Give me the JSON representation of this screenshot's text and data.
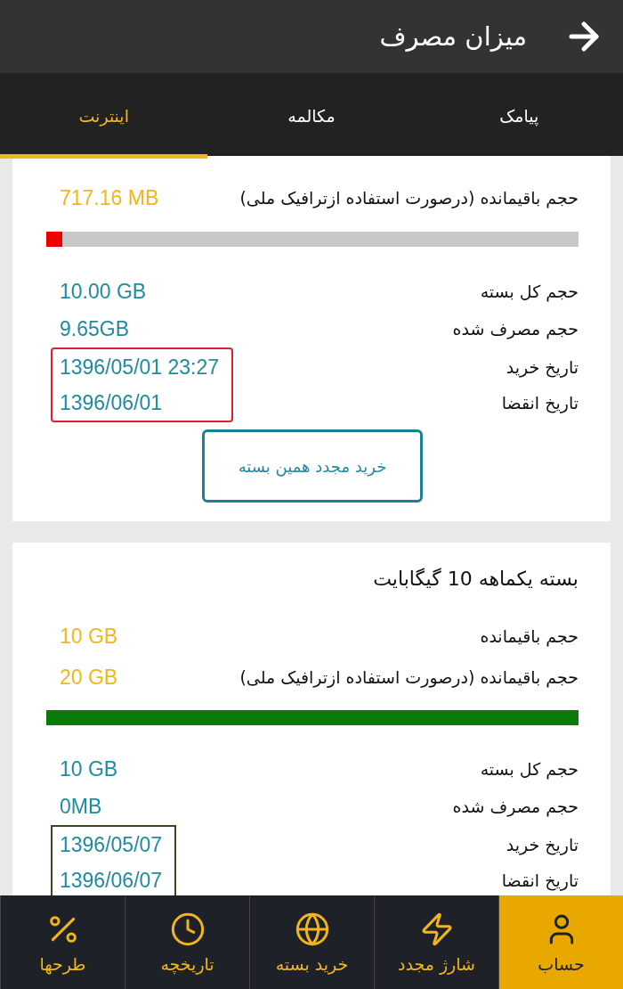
{
  "header": {
    "title": "میزان مصرف"
  },
  "tabs": [
    {
      "label": "پیامک",
      "selected": false
    },
    {
      "label": "مکالمه",
      "selected": false
    },
    {
      "label": "اینترنت",
      "selected": true
    }
  ],
  "cards": [
    {
      "remaining": [
        {
          "label": "حجم باقیمانده (درصورت استفاده ازترافیک ملی)",
          "value": "717.16 MB"
        }
      ],
      "bar": {
        "level": 0.03,
        "color": "#ee0000"
      },
      "details": [
        {
          "label": "حجم کل بسته",
          "value": "10.00 GB"
        },
        {
          "label": "حجم مصرف شده",
          "value": "9.65GB"
        }
      ],
      "dates": [
        {
          "label": "تاریخ خرید",
          "value": "1396/05/01 23:27"
        },
        {
          "label": "تاریخ انقضا",
          "value": "1396/06/01"
        }
      ],
      "color": "#e0202a",
      "button": "خرید مجدد همین بسته"
    },
    {
      "title": "بسته یکماهه 10 گیگابایت",
      "remaining": [
        {
          "label": "حجم باقیمانده",
          "value": "10 GB"
        },
        {
          "label": "حجم باقیمانده (درصورت استفاده ازترافیک ملی)",
          "value": "20 GB"
        }
      ],
      "bar": {
        "level": 1,
        "color": "#0a7a0a"
      },
      "details": [
        {
          "label": "حجم کل بسته",
          "value": "10 GB"
        },
        {
          "label": "حجم مصرف شده",
          "value": "0MB"
        }
      ],
      "dates": [
        {
          "label": "تاریخ خرید",
          "value": "1396/05/07"
        },
        {
          "label": "تاریخ انقضا",
          "value": "1396/06/07"
        }
      ],
      "color": "#3a4a1a"
    }
  ],
  "nav": [
    {
      "label": "حساب",
      "selected": true
    },
    {
      "label": "شارژ مجدد",
      "selected": false
    },
    {
      "label": "خرید بسته",
      "selected": false
    },
    {
      "label": "تاریخچه",
      "selected": false
    },
    {
      "label": "طرحها",
      "selected": false
    }
  ]
}
